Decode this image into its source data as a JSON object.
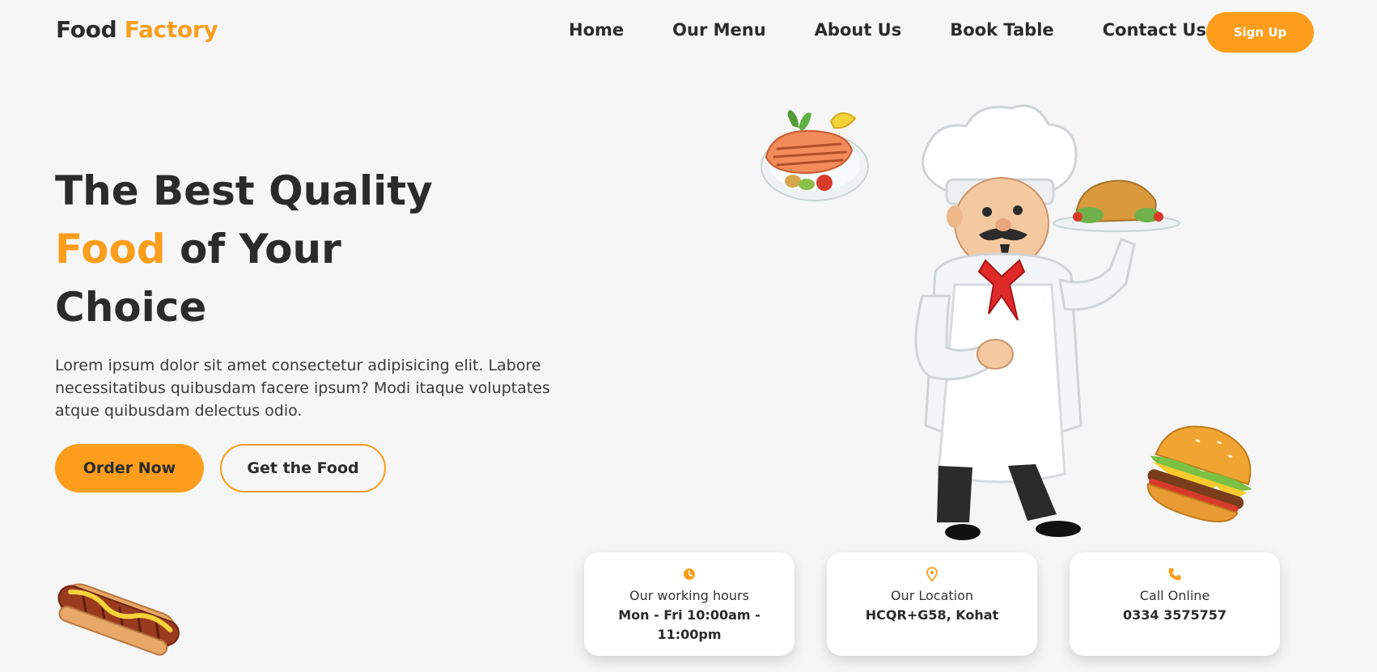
{
  "brand": {
    "name_part1": "Food",
    "name_part2": "Factory"
  },
  "nav": {
    "items": [
      "Home",
      "Our Menu",
      "About Us",
      "Book Table",
      "Contact Us"
    ],
    "signup_label": "Sign Up"
  },
  "hero": {
    "title_line1": "The Best Quality",
    "title_accent": "Food",
    "title_line2_rest": " of Your",
    "title_line3": "Choice",
    "description": "Lorem ipsum dolor sit amet consectetur adipisicing elit. Labore necessitatibus quibusdam facere ipsum? Modi itaque voluptates atque quibusdam delectus odio.",
    "order_label": "Order Now",
    "get_food_label": "Get the Food"
  },
  "info_cards": [
    {
      "icon": "clock-icon",
      "label": "Our working hours",
      "value": "Mon - Fri 10:00am - 11:00pm"
    },
    {
      "icon": "location-pin-icon",
      "label": "Our Location",
      "value": "HCQR+G58, Kohat"
    },
    {
      "icon": "phone-icon",
      "label": "Call Online",
      "value": "0334 3575757"
    }
  ],
  "colors": {
    "accent": "#fd9d1c",
    "text": "#2b2b2b",
    "background": "#f6f6f6"
  }
}
